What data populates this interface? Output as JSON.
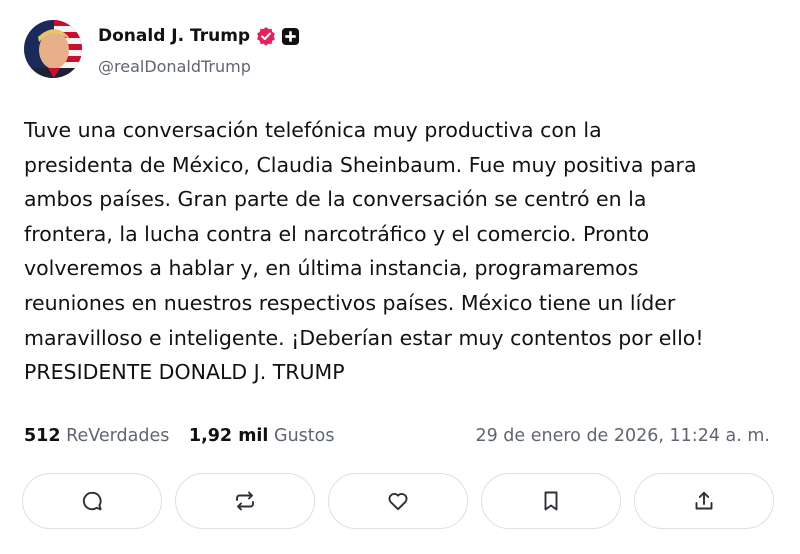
{
  "post": {
    "author": {
      "display_name": "Donald J. Trump",
      "handle": "@realDonaldTrump",
      "verified_color": "#e0245e"
    },
    "text_lines": [
      "Tuve una conversación telefónica muy productiva con la",
      "presidenta de México, Claudia Sheinbaum. Fue muy positiva para",
      "ambos países. Gran parte de la conversación se centró en la",
      "frontera, la lucha contra el narcotráfico y el comercio. Pronto",
      "volveremos a hablar y, en última instancia, programaremos",
      "reuniones en nuestros respectivos países. México tiene un líder",
      "maravilloso e inteligente. ¡Deberían estar muy contentos por ello!",
      "PRESIDENTE DONALD J. TRUMP"
    ],
    "stats": {
      "reposts_count": "512",
      "reposts_label": "ReVerdades",
      "likes_count": "1,92 mil",
      "likes_label": "Gustos",
      "timestamp": "29 de enero de 2026, 11:24 a. m."
    },
    "actions": [
      {
        "name": "reply-button",
        "icon": "reply-icon"
      },
      {
        "name": "retruth-button",
        "icon": "repost-icon"
      },
      {
        "name": "like-button",
        "icon": "heart-icon"
      },
      {
        "name": "bookmark-button",
        "icon": "bookmark-icon"
      },
      {
        "name": "share-button",
        "icon": "share-icon"
      }
    ]
  }
}
